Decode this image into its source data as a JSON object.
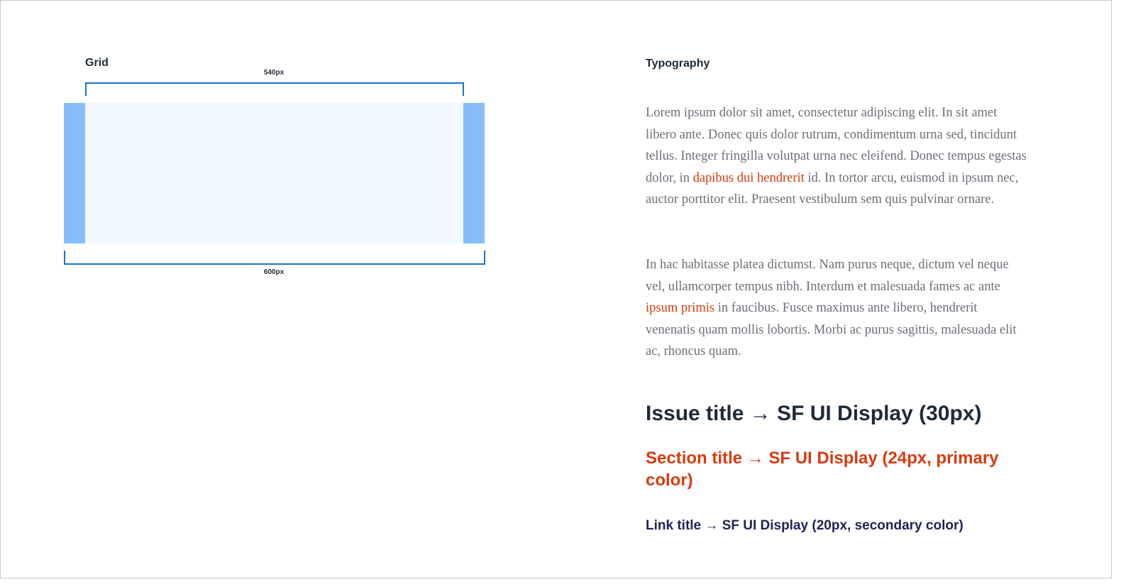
{
  "grid": {
    "title": "Grid",
    "inner_width_label": "540px",
    "outer_width_label": "600px"
  },
  "typography": {
    "title": "Typography",
    "paragraph1": {
      "before": "Lorem ipsum dolor sit amet, consectetur adipiscing elit. In sit amet libero ante. Donec quis dolor rutrum, condimentum urna sed, tincidunt tellus. Integer fringilla volutpat urna nec eleifend. Donec tempus egestas dolor, in ",
      "link": "dapibus dui hendrerit",
      "after": " id. In tortor arcu, euismod in ipsum nec, auctor porttitor elit. Praesent vestibulum sem quis pulvinar ornare."
    },
    "paragraph2": {
      "before": "In hac habitasse platea dictumst. Nam purus neque, dictum vel neque vel, ullamcorper tempus nibh. Interdum et malesuada fames ac ante ",
      "link": "ipsum primis",
      "after": " in faucibus. Fusce maximus ante libero, hendrerit venenatis quam mollis lobortis. Morbi ac purus sagittis, malesuada elit ac, rhoncus quam."
    },
    "issue_title": "Issue title → SF UI Display (30px)",
    "section_title": "Section title → SF UI Display (24px, primary color)",
    "link_title": "Link title → SF UI Display (20px, secondary color)"
  },
  "colors": {
    "primary": "#d63b0f",
    "secondary": "#1f2355",
    "gutter": "#85bdf9",
    "content_area": "#f0f7ff",
    "bracket": "#1a73c7",
    "body_text": "#6b6f78",
    "heading": "#1f2a3a"
  }
}
